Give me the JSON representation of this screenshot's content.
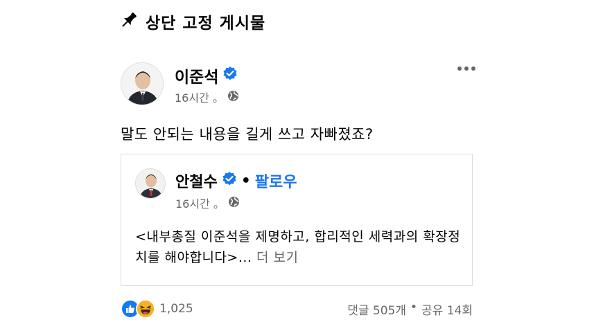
{
  "pinned": {
    "label": "상단 고정 게시물",
    "icon": "pushpin-icon"
  },
  "post": {
    "author": "이준석",
    "time": "16시간",
    "dot": "。",
    "text": "말도 안되는 내용을 길게 쓰고 자빠졌죠?"
  },
  "shared": {
    "author": "안철수",
    "bullet": "•",
    "follow": "팔로우",
    "time": "16시간",
    "dot": "。",
    "body": "<내부총질 이준석을 제명하고, 합리적인 세력과의 확장정치를 해야합니다>...",
    "see_more": "더 보기"
  },
  "footer": {
    "reaction_count": "1,025",
    "comments": "댓글 505개",
    "separator": "•",
    "shares": "공유 14회"
  },
  "colors": {
    "verified": "#1877f2",
    "link": "#1877f2",
    "muted": "#65676b"
  }
}
